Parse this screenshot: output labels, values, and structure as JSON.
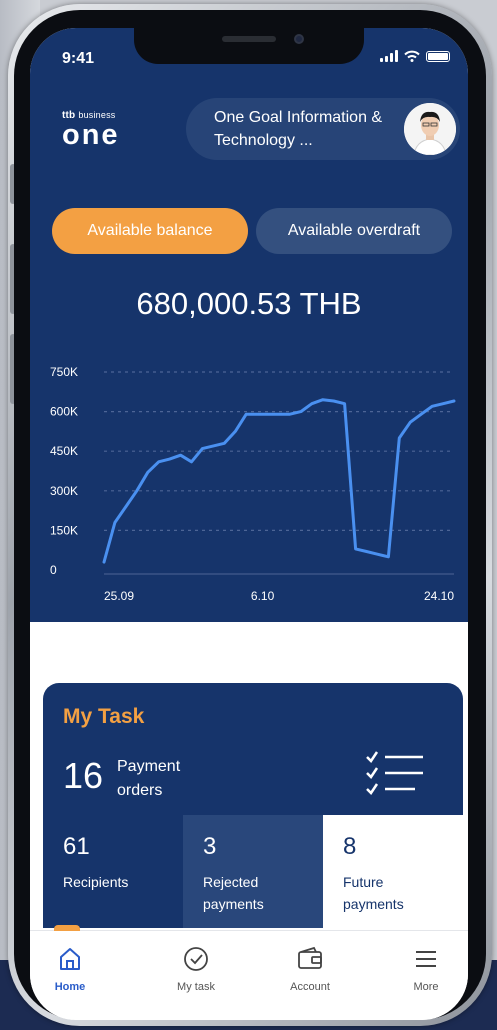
{
  "status_bar": {
    "time": "9:41"
  },
  "brand": {
    "small_prefix": "ttb",
    "small_suffix": "business",
    "name": "one"
  },
  "account": {
    "company_name": "One Goal Information & Technology ..."
  },
  "balance_tabs": [
    {
      "label": "Available balance",
      "active": true
    },
    {
      "label": "Available overdraft",
      "active": false
    }
  ],
  "balance": {
    "amount": "680,000.53 THB"
  },
  "chart_data": {
    "type": "line",
    "title": "",
    "xlabel": "",
    "ylabel": "",
    "y_tick_labels": [
      "0",
      "150K",
      "300K",
      "450K",
      "600K",
      "750K"
    ],
    "y_ticks": [
      0,
      150000,
      300000,
      450000,
      600000,
      750000
    ],
    "x_tick_labels": [
      "25.09",
      "6.10",
      "24.10"
    ],
    "ylim": [
      0,
      750000
    ],
    "grid": true,
    "series": [
      {
        "color": "#4a90f0",
        "x": [
          0,
          1,
          2,
          3,
          4,
          5,
          6,
          7,
          8,
          9,
          10,
          11,
          12,
          13,
          14,
          15,
          16,
          17,
          18,
          19,
          20,
          21,
          22,
          23,
          24,
          25,
          26,
          27,
          28,
          29,
          30,
          31,
          32
        ],
        "y": [
          30000,
          180000,
          240000,
          300000,
          370000,
          410000,
          420000,
          435000,
          410000,
          460000,
          470000,
          480000,
          525000,
          590000,
          590000,
          590000,
          590000,
          590000,
          600000,
          630000,
          645000,
          640000,
          630000,
          80000,
          70000,
          60000,
          50000,
          500000,
          560000,
          590000,
          620000,
          630000,
          640000
        ]
      }
    ]
  },
  "my_task": {
    "title": "My Task",
    "payment_orders_count": "16",
    "payment_orders_label": "Payment orders",
    "stats": [
      {
        "count": "61",
        "label": "Recipients"
      },
      {
        "count": "3",
        "label": "Rejected payments"
      },
      {
        "count": "8",
        "label": "Future payments"
      }
    ]
  },
  "nav": [
    {
      "label": "Home",
      "icon": "home-icon",
      "active": true
    },
    {
      "label": "My task",
      "icon": "check-circle-icon",
      "active": false
    },
    {
      "label": "Account",
      "icon": "wallet-icon",
      "active": false
    },
    {
      "label": "More",
      "icon": "menu-icon",
      "active": false
    }
  ],
  "colors": {
    "primary": "#16346b",
    "accent": "#f3a043",
    "chart_line": "#4a90f0",
    "nav_active": "#2a5cc9"
  }
}
